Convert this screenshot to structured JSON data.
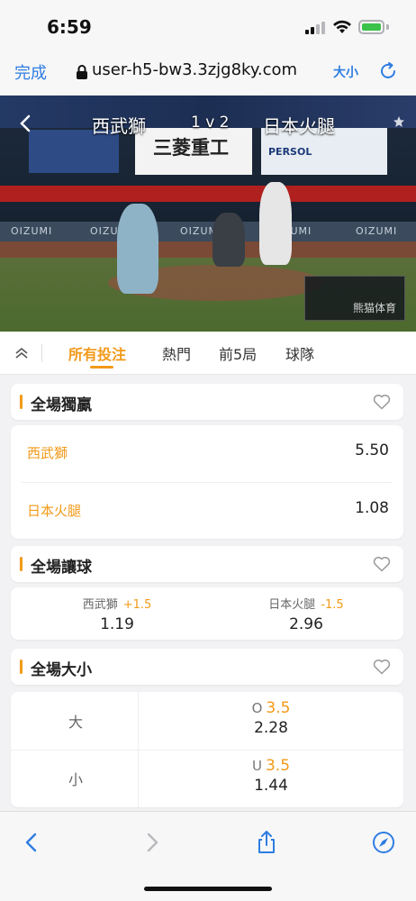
{
  "status": {
    "time": "6:59"
  },
  "browser": {
    "done_label": "完成",
    "url": "user-h5-bw3.3zjg8ky.com",
    "text_size_label": "大小"
  },
  "video": {
    "home_team": "西武獅",
    "score": "1 v 2",
    "away_team": "日本火腿",
    "sponsor": "三菱重工",
    "wall_text": "OIZUMI",
    "persol": "PERSOL",
    "watermark": "熊猫体育"
  },
  "tabs": [
    {
      "label": "所有投注",
      "active": true
    },
    {
      "label": "熱門",
      "active": false
    },
    {
      "label": "前5局",
      "active": false
    },
    {
      "label": "球隊",
      "active": false
    }
  ],
  "moneyline": {
    "title": "全場獨贏",
    "rows": [
      {
        "team": "西武獅",
        "odds": "5.50"
      },
      {
        "team": "日本火腿",
        "odds": "1.08"
      }
    ]
  },
  "handicap": {
    "title": "全場讓球",
    "cells": [
      {
        "team": "西武獅",
        "line": "+1.5",
        "odds": "1.19"
      },
      {
        "team": "日本火腿",
        "line": "-1.5",
        "odds": "2.96"
      }
    ]
  },
  "totals": {
    "title": "全場大小",
    "rows": [
      {
        "side": "大",
        "prefix": "O",
        "line": "3.5",
        "odds": "2.28"
      },
      {
        "side": "小",
        "prefix": "U",
        "line": "3.5",
        "odds": "1.44"
      }
    ]
  },
  "colors": {
    "accent": "#f29a19",
    "link": "#2f7de1"
  }
}
